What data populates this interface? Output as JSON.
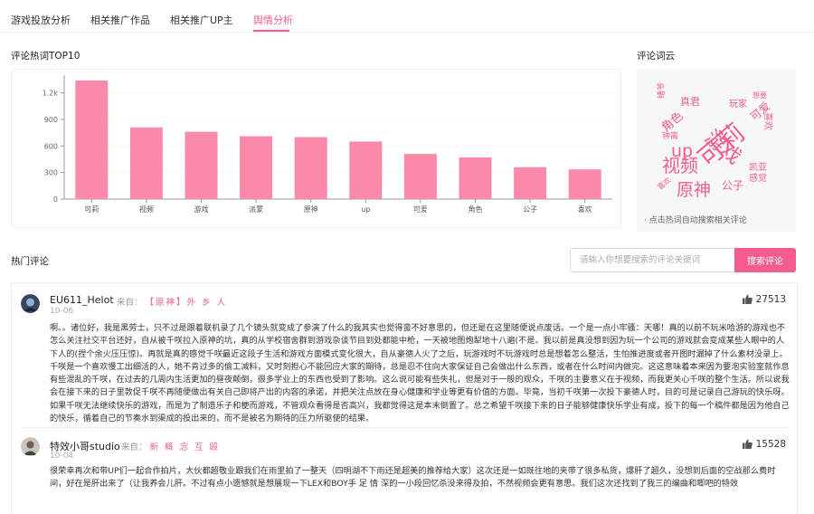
{
  "tabs": [
    {
      "label": "游戏投放分析",
      "active": false
    },
    {
      "label": "相关推广作品",
      "active": false
    },
    {
      "label": "相关推广UP主",
      "active": false
    },
    {
      "label": "舆情分析",
      "active": true
    }
  ],
  "colors": {
    "accent": "#f25d8e",
    "bar": "#fb8aaa"
  },
  "hot_words": {
    "title": "评论热词TOP10"
  },
  "chart_data": {
    "type": "bar",
    "categories": [
      "可莉",
      "视频",
      "游戏",
      "派蒙",
      "原神",
      "up",
      "可爱",
      "角色",
      "公子",
      "喜欢"
    ],
    "values": [
      1340,
      810,
      760,
      710,
      700,
      650,
      510,
      470,
      360,
      335
    ],
    "yticks": [
      "0",
      "300",
      "600",
      "900",
      "1.2k"
    ],
    "ylim": [
      0,
      1400
    ],
    "grid": true
  },
  "word_cloud": {
    "title": "评论词云",
    "hint": "· 点击热词自动搜索相关评论",
    "words": [
      "游戏",
      "可莉",
      "视频",
      "原神",
      "up",
      "角色",
      "真君",
      "玩家",
      "喜欢",
      "可爱",
      "钟离",
      "凯亚",
      "公子",
      "感觉",
      "绪爷",
      "喜欢",
      "想要"
    ]
  },
  "comments_section": {
    "title": "热门评论",
    "search_placeholder": "请输入你想要搜索的评论关键词",
    "search_button": "搜索评论",
    "from_label": "来自：",
    "items": [
      {
        "username": "EU611_Helot",
        "source": "【原神】外 乡 人",
        "date": "10-06",
        "likes": "27513",
        "text": "啊。。诸位好，我是黑劳士，只不过是跟着联机录了几个镜头就变成了参演了什么的我其实也觉得蛮不好意思的，但还是在这里随便说点废话。一个是一点小牢骚：天哪！真的以前不玩米哈游的游戏也不怎么关注社交平台还好，自从被千咲拉入原神的坑，真的从学校宿舍群到游戏杂谈节目到处都能中枪，一天被地图炮犁地十八遍(不是。我以前是真没想到因为玩一个公司的游戏就会变成某些人眼中的人下人的(捏个余火压压惊)。再就是真的感觉千咲最近这段子生活和游戏方面模式变化很大，自从豪德人火了之后，玩游戏时不玩游戏时总是想着怎么整活，生怕推进度或者开图时漏掉了什么素材没录上。千咲是一个喜欢慢工出细活的人，她不肯过多的偷工减料，又时刻担心不能回应大家的期待，总是忍不住向大家保证自己会做出什么东西，或者在什么时间内做完。这这意味着本来因为要泡实验室就作息有些混乱的千咲，在过去的几周内生活更加的昼夜颠倒，很多学业上的东西也受到了影响。这么说可能有些失礼，但是对于一般的观众，千咲的主要意义在于视频，而我更关心千咲的整个生活。所以说我会在接下来的日子里敦促千咲不再随便做出有关自己即将产出的内容的承诺，并把关注点放在身心健康和学业等更有价值的方面。毕竟，当初千咲第一次投下豪德人时，目的可是记录自己游玩的快乐呀。如果千咲无法继续快乐的游戏，而是为了制造乐子和梗而游戏，不管观众看得是否高兴，我都觉得这是本末倒置了。总之希望千咲接下来的日子能够健康快乐学业有成，投下的每一个稿件都是因为他自己的快乐，循着自己的节奏水到渠成的投出来的，而不是被名为期待的压力所驱使的结果。"
      },
      {
        "username": "特效小哥studio",
        "source": "新 概 念 互 殴",
        "date": "10-04",
        "likes": "15528",
        "text": "很荣幸再次和带UP们一起合作拍片，大伙都超敬业跟我们在雨里拍了一整天（四明湖不下雨还是超美的推荐给大家）这次还是一如既往地的夹带了很多私货，爆肝了超久，没想到后面的空战那么费时间，好在是肝出来了（让我养会儿肝。不过有点小遗憾就是想展现一下LEX和BOY手 足 情 深的一小段回忆杀没来得及拍，不然视频会更有意思。我们这次还找到了我三的编曲和唧吧的特效"
      }
    ]
  }
}
